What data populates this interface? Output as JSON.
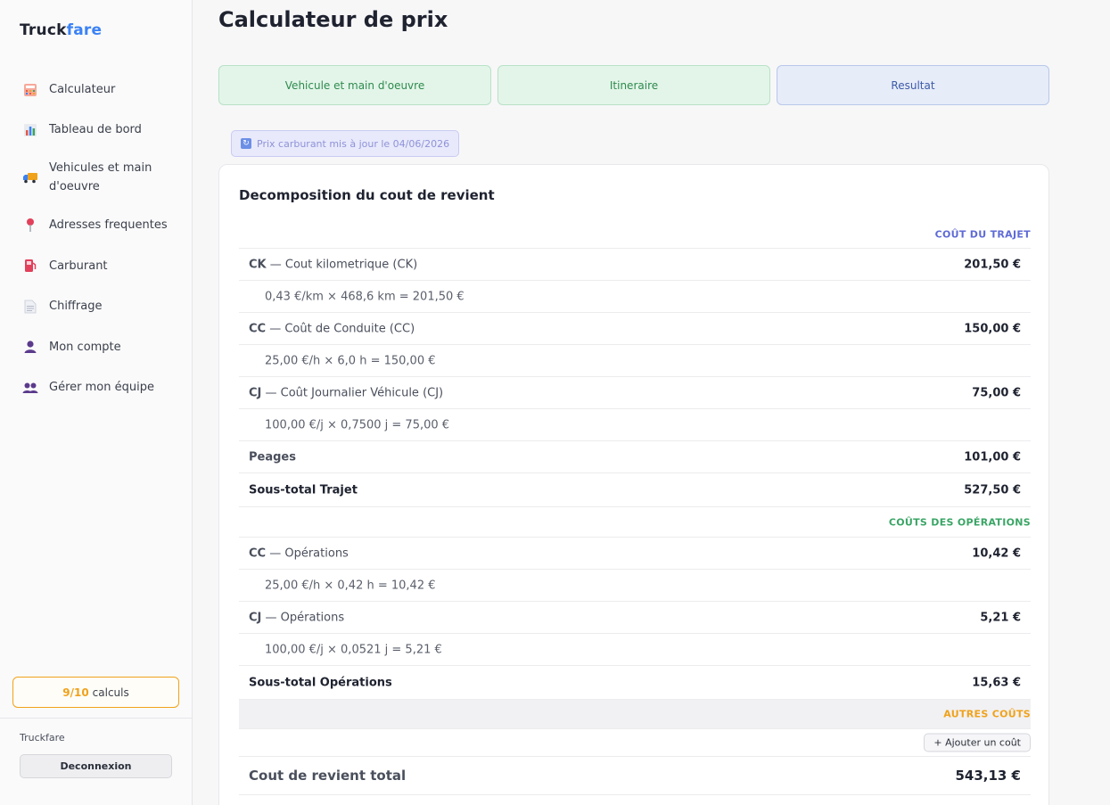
{
  "brand": {
    "part1": "Truck",
    "part2": "fare"
  },
  "sidebar": {
    "items": [
      {
        "label": "Calculateur",
        "icon": "calculator-icon"
      },
      {
        "label": "Tableau de bord",
        "icon": "bar-chart-icon"
      },
      {
        "label": "Vehicules et main d'oeuvre",
        "icon": "truck-icon"
      },
      {
        "label": "Adresses frequentes",
        "icon": "pin-icon"
      },
      {
        "label": "Carburant",
        "icon": "fuel-pump-icon"
      },
      {
        "label": "Chiffrage",
        "icon": "document-icon"
      },
      {
        "label": "Mon compte",
        "icon": "user-icon"
      },
      {
        "label": "Gérer mon équipe",
        "icon": "team-icon"
      }
    ],
    "quota": {
      "used": "9/10",
      "label": "calculs"
    },
    "footer_name": "Truckfare",
    "logout_label": "Deconnexion"
  },
  "header": {
    "title": "Calculateur de prix"
  },
  "steps": [
    {
      "label": "Vehicule et main d'oeuvre",
      "state": "done"
    },
    {
      "label": "Itineraire",
      "state": "done"
    },
    {
      "label": "Resultat",
      "state": "active"
    }
  ],
  "fuel_badge": {
    "text": "Prix carburant mis à jour le 04/06/2026"
  },
  "breakdown": {
    "title": "Decomposition du cout de revient",
    "sections": {
      "trajet": "COÛT DU TRAJET",
      "operations": "COÛTS DES OPÉRATIONS",
      "autres": "AUTRES COÛTS"
    },
    "trajet_rows": {
      "ck": {
        "code": "CK",
        "label": " — Cout kilometrique (CK)",
        "value": "201,50 €",
        "detail": "0,43 €/km × 468,6 km = 201,50 €"
      },
      "cc": {
        "code": "CC",
        "label": " — Coût de Conduite (CC)",
        "value": "150,00 €",
        "detail": "25,00 €/h × 6,0 h = 150,00 €"
      },
      "cj": {
        "code": "CJ",
        "label": " — Coût Journalier Véhicule (CJ)",
        "value": "75,00 €",
        "detail": "100,00 €/j × 0,7500 j = 75,00 €"
      },
      "peages": {
        "label": "Peages",
        "value": "101,00 €"
      },
      "subtotal": {
        "label": "Sous-total Trajet",
        "value": "527,50 €"
      }
    },
    "operations_rows": {
      "cc": {
        "code": "CC",
        "label": " — Opérations",
        "value": "10,42 €",
        "detail": "25,00 €/h × 0,42 h = 10,42 €"
      },
      "cj": {
        "code": "CJ",
        "label": " — Opérations",
        "value": "5,21 €",
        "detail": "100,00 €/j × 0,0521 j = 5,21 €"
      },
      "subtotal": {
        "label": "Sous-total Opérations",
        "value": "15,63 €"
      }
    },
    "add_cost_label": "+ Ajouter un coût",
    "total": {
      "label": "Cout de revient total",
      "value": "543,13 €"
    }
  },
  "colors": {
    "accent": "#3b82f6",
    "quota": "#f0a21b",
    "trajet": "#5f6ad6",
    "operations": "#3aa565",
    "autres": "#f0a21b"
  }
}
